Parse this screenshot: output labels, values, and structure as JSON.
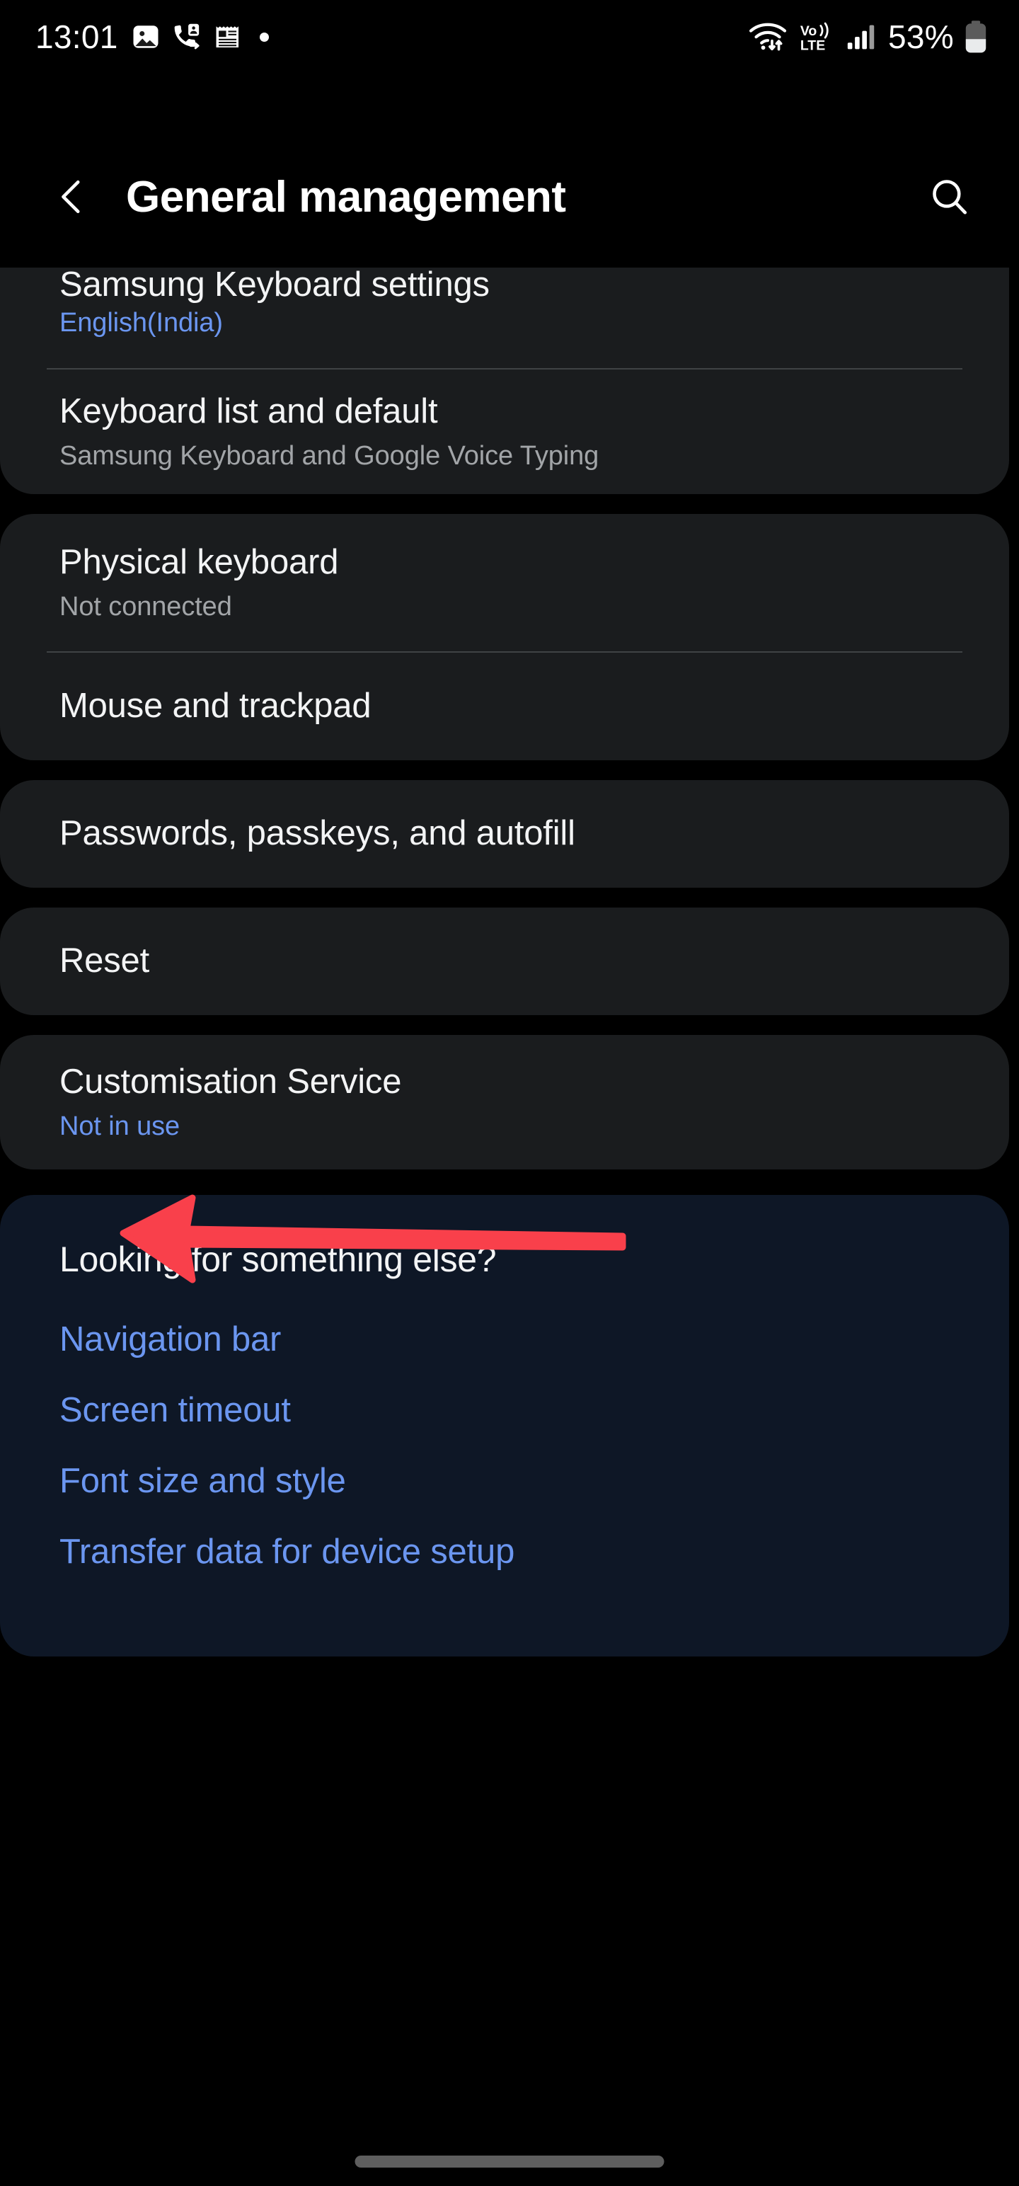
{
  "status_bar": {
    "time": "13:01",
    "left_icons": [
      "image-icon",
      "call-forward-icon",
      "notepad-icon",
      "dot-indicator"
    ],
    "right_icons": [
      "wifi-icon",
      "volte-icon",
      "signal-icon",
      "battery-icon"
    ],
    "volte_label_top": "Vo",
    "volte_label_bottom": "LTE",
    "battery_percent": "53%"
  },
  "header": {
    "back_icon": "chevron-left-icon",
    "title": "General management",
    "search_icon": "search-icon"
  },
  "colors": {
    "background": "#000000",
    "card": "#1a1c1e",
    "panel": "#0e1726",
    "accent_blue": "#6b96f0",
    "title_text": "#f3f4f5",
    "sub_text": "#a2a5a8",
    "divider": "#3f4245",
    "annotation_red": "#f9404b",
    "nav_handle": "#5e5e5e"
  },
  "cards": [
    {
      "clipped_top": true,
      "rows": [
        {
          "title": "Samsung Keyboard settings",
          "sub": "English(India)",
          "sub_style": "blue"
        },
        {
          "title": "Keyboard list and default",
          "sub": "Samsung Keyboard and Google Voice Typing",
          "sub_style": "gray"
        }
      ]
    },
    {
      "clipped_top": false,
      "rows": [
        {
          "title": "Physical keyboard",
          "sub": "Not connected",
          "sub_style": "gray"
        },
        {
          "title": "Mouse and trackpad",
          "sub": "",
          "sub_style": "none"
        }
      ]
    },
    {
      "clipped_top": false,
      "rows": [
        {
          "title": "Passwords, passkeys, and autofill",
          "sub": "",
          "sub_style": "none"
        }
      ]
    },
    {
      "clipped_top": false,
      "rows": [
        {
          "title": "Reset",
          "sub": "",
          "sub_style": "none"
        }
      ]
    },
    {
      "clipped_top": false,
      "rows": [
        {
          "title": "Customisation Service",
          "sub": "Not in use",
          "sub_style": "blue"
        }
      ]
    }
  ],
  "suggestion_panel": {
    "title": "Looking for something else?",
    "links": [
      "Navigation bar",
      "Screen timeout",
      "Font size and style",
      "Transfer data for device setup"
    ]
  },
  "annotation": {
    "type": "arrow-left",
    "color": "#f9404b",
    "points_at": "Reset"
  },
  "nav_bar": {
    "handle": "gesture-handle"
  }
}
